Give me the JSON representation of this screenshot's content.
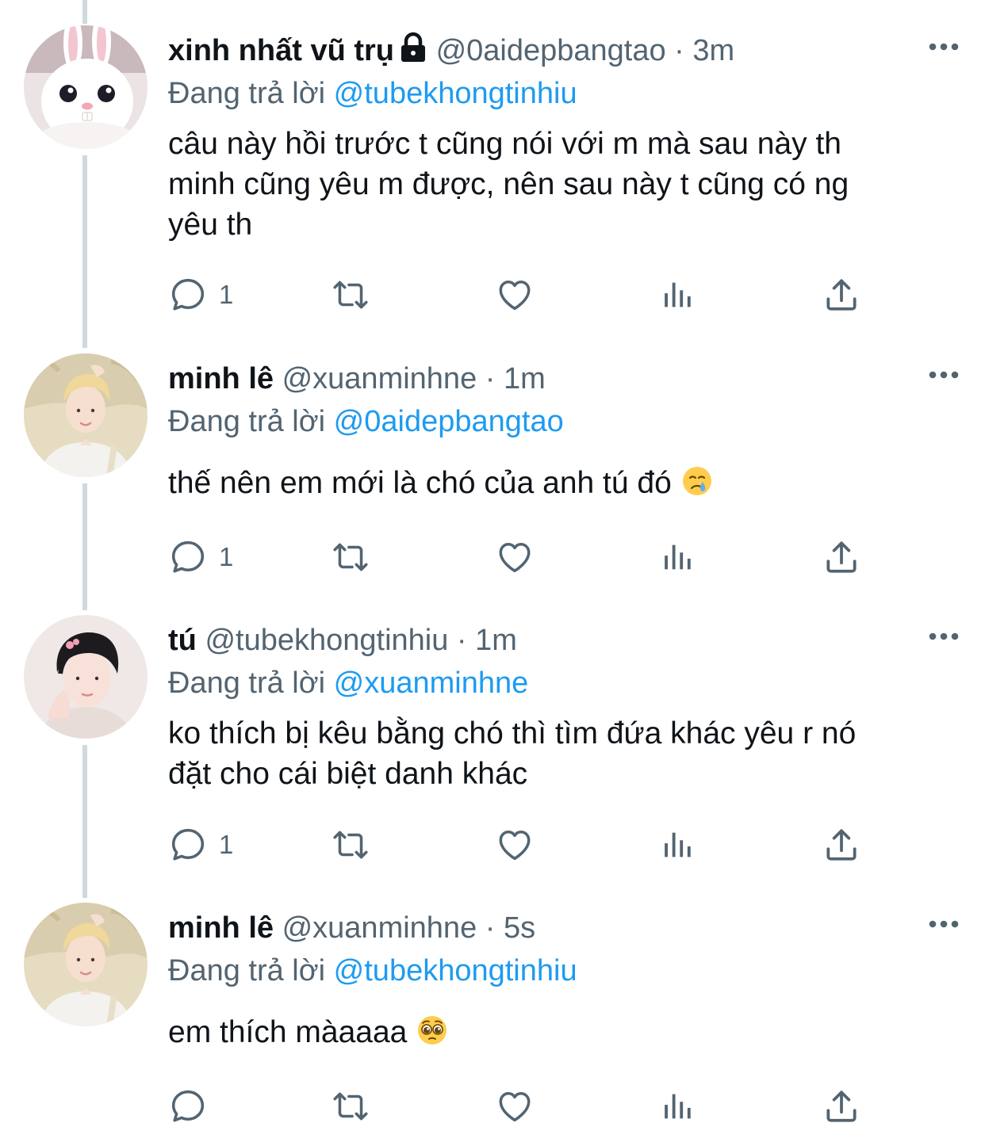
{
  "reply_prefix": "Đang trả lời",
  "colors": {
    "text": "#0f1419",
    "secondary": "#536471",
    "accent": "#1d9bf0",
    "thread_line": "#cfd9de"
  },
  "tweets": [
    {
      "name": "xinh nhất vũ trụ",
      "protected": true,
      "handle": "@0aidepbangtao",
      "separator": "·",
      "time": "3m",
      "replying_to": "@tubekhongtinhiu",
      "lines": [
        "câu này hồi trước t cũng nói với m mà sau này th",
        "minh cũng yêu m được, nên sau này t cũng có ng",
        "yêu th"
      ],
      "reply_count": "1",
      "avatar": "bunny"
    },
    {
      "name": "minh lê",
      "handle": "@xuanminhne",
      "separator": "·",
      "time": "1m",
      "replying_to": "@0aidepbangtao",
      "lines": [
        "thế nên em mới là chó của anh tú đó"
      ],
      "emoji": "crying-face",
      "reply_count": "1",
      "avatar": "blond-boy"
    },
    {
      "name": "tú",
      "handle": "@tubekhongtinhiu",
      "separator": "·",
      "time": "1m",
      "replying_to": "@xuanminhne",
      "lines": [
        "ko thích bị kêu bằng chó thì tìm đứa khác yêu r nó",
        "đặt cho cái biệt danh khác"
      ],
      "reply_count": "1",
      "avatar": "dark-hair-boy"
    },
    {
      "name": "minh lê",
      "handle": "@xuanminhne",
      "separator": "·",
      "time": "5s",
      "replying_to": "@tubekhongtinhiu",
      "lines": [
        "em thích màaaaa"
      ],
      "emoji": "pleading-face",
      "reply_count": "",
      "avatar": "blond-boy"
    }
  ]
}
